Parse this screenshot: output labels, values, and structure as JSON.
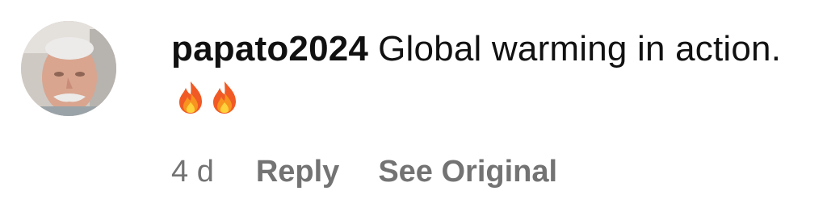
{
  "comment": {
    "username": "papato2024",
    "text": "Global warming in action.",
    "emoji_icons": [
      "fire-emoji",
      "fire-emoji"
    ],
    "timestamp": "4 d",
    "reply_label": "Reply",
    "see_original_label": "See Original"
  },
  "colors": {
    "text": "#111111",
    "meta": "#737373",
    "background": "#ffffff"
  }
}
